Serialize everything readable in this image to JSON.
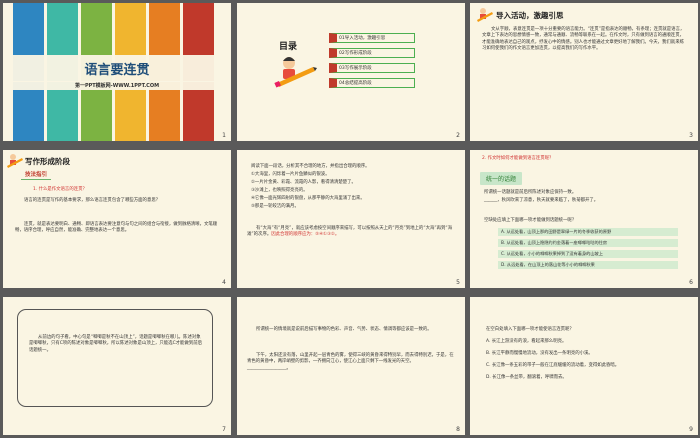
{
  "slide1": {
    "title": "语言要连贯",
    "subtitle": "第一PPT模板网-WWW.1PPT.COM",
    "number": "1",
    "strip_colors": [
      "#2e86c1",
      "#3fb8a5",
      "#7cb342",
      "#f0b52f",
      "#e67e22",
      "#c0392b"
    ]
  },
  "slide2": {
    "toc_title": "目录",
    "items": [
      "01导入活动，激趣引思",
      "02写作形成阶段",
      "03写作展示阶段",
      "04总结提高阶段"
    ],
    "number": "2"
  },
  "slide3": {
    "heading": "导入活动，激趣引思",
    "body": "文从字顺，表意连贯是一项十分重要的语言能力。“连贯”是指表达的顺畅，有条理；连贯就是语言，文章上下表达的思想情感一致，通常与通顺、流畅等联系在一起。在作文时，只有做到语言的通顺连贯，才能准确地表达自己的观点，抒发心中的情感。别人也才能通过文章更好地了解我们。今天，我们就来练习如何使我们的作文语言更加连贯，以提高我们的写作水平。",
    "number": "3"
  },
  "slide4": {
    "heading": "写作形成阶段",
    "tag": "技法指引",
    "question": "1. 什么是作文语言的连贯？",
    "para1": "语言的连贯是写作的基本要求，那么语言连贯包含了哪些方面的意思？",
    "para2": "连贯，就是表达要明白、通畅、即语言表达要注意句与句之间的组合与衔接，做到脉络清晰，文笔顺畅，语序合理，呼应自然，能准确、完整地表达一个意思。",
    "number": "4"
  },
  "slide5": {
    "intro": "阅读下面一段话，分析其不合理的地方，并指出合理的顺序。",
    "lines": [
      "①大海里，闪烁着一片片鱼鳞似的银波。",
      "②一片片金黄、彩霞、流霞的人影，看得清清楚楚了。",
      "③沙滩上，也映照得亮亮的。",
      "④它像一面光辉四射的银盘，从那平静的大海里涌了出来。",
      "⑤那是一轮皎洁的满月。"
    ],
    "analysis": "有“大海”有“月亮”，就应该考虑按空间顺序来描写，可以按照从天上的“月亮”到地上的“大海”再到“海滩”的次序。",
    "answer_label": "因此合理的顺序应为：",
    "answer": "⑤④①③②。",
    "number": "5"
  },
  "slide6": {
    "question": "2. 作文时如何才能做到语言连贯呢？",
    "tag": "统一的话题",
    "para": "所谓统一话题就是前后所陈述对象应保持一致。",
    "example": "______，秋风吹来了凉意，秋天就要来临了，秋菊都开了。",
    "example2": "空缺处应填上下面哪一项才能做到话题统一呢？",
    "options": [
      "A. 从远处看，山顶上那的田野是翠绿一片的冬季收获的原野",
      "B. 从远处看，山顶上隐隐约约金落着一座唧唧咕咕的住房",
      "C. 从远处看，小小的唧唧秋果掉到了没有着身的山坡上",
      "D. 从远处看，在山顶上的落山花等小小的唧唧秋果"
    ],
    "number": "6"
  },
  "slide7": {
    "text": "从前边的句子看，中心句是“唧唧是秋不在山顶上”，话题是唧唧秋在哪儿。陈述对象是唧唧秋，只有C项的陈述对象是唧唧秋，所以陈述对象是山顶上，只能选C才能做到前后话题统一。",
    "number": "7"
  },
  "slide8": {
    "para1": "所谓统一的情境就是说前后描写事物的色彩、声音、气势、状态、情调等都应该是一致的。",
    "para2": "下午，太阳还没有落，山里开起一层青色的雾，使得三峡的黄昏来得特别早，而去得特别迟，于是，在青色的黄昏中，两岸峭壁的剪影，一齐拥向江心，使江心上面只剩下一线发光的天空。",
    "blank": "__________________。",
    "number": "8"
  },
  "slide9": {
    "question": "在空白处填入下面哪一项才能使语言连贯呢？",
    "options": [
      "A. 长江上游没有的浪，看起来那么明亮。",
      "B. 长江平静而慢慢地流动，没有发出一条明亮的小溪。",
      "C. 长江像一条五彩的带子一般在江底缓缓的流动着，变得如此昏暗。",
      "D. 长江像一条丝带，翻滚着，呼啸而去。"
    ],
    "number": "9"
  }
}
